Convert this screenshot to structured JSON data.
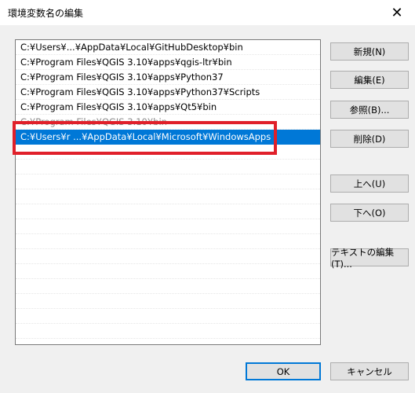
{
  "window": {
    "title": "環境変数名の編集",
    "close_glyph": "✕"
  },
  "paths": [
    {
      "text": "C:¥Users¥...¥AppData¥Local¥GitHubDesktop¥bin",
      "selected": false,
      "faded": false
    },
    {
      "text": "C:¥Program Files¥QGIS 3.10¥apps¥qgis-ltr¥bin",
      "selected": false,
      "faded": false
    },
    {
      "text": "C:¥Program Files¥QGIS 3.10¥apps¥Python37",
      "selected": false,
      "faded": false
    },
    {
      "text": "C:¥Program Files¥QGIS 3.10¥apps¥Python37¥Scripts",
      "selected": false,
      "faded": false
    },
    {
      "text": "C:¥Program Files¥QGIS 3.10¥apps¥Qt5¥bin",
      "selected": false,
      "faded": false
    },
    {
      "text": "C:¥Program Files¥QGIS 3.10¥bin",
      "selected": false,
      "faded": true
    },
    {
      "text": "C:¥Users¥r ...¥AppData¥Local¥Microsoft¥WindowsApps",
      "selected": true,
      "faded": false
    }
  ],
  "buttons": {
    "new": "新規(N)",
    "edit": "編集(E)",
    "browse": "参照(B)...",
    "delete": "削除(D)",
    "up": "上へ(U)",
    "down": "下へ(O)",
    "edit_text": "テキストの編集(T)...",
    "ok": "OK",
    "cancel": "キャンセル"
  },
  "colors": {
    "selection": "#0078d7",
    "highlight_box": "#e0202a"
  }
}
